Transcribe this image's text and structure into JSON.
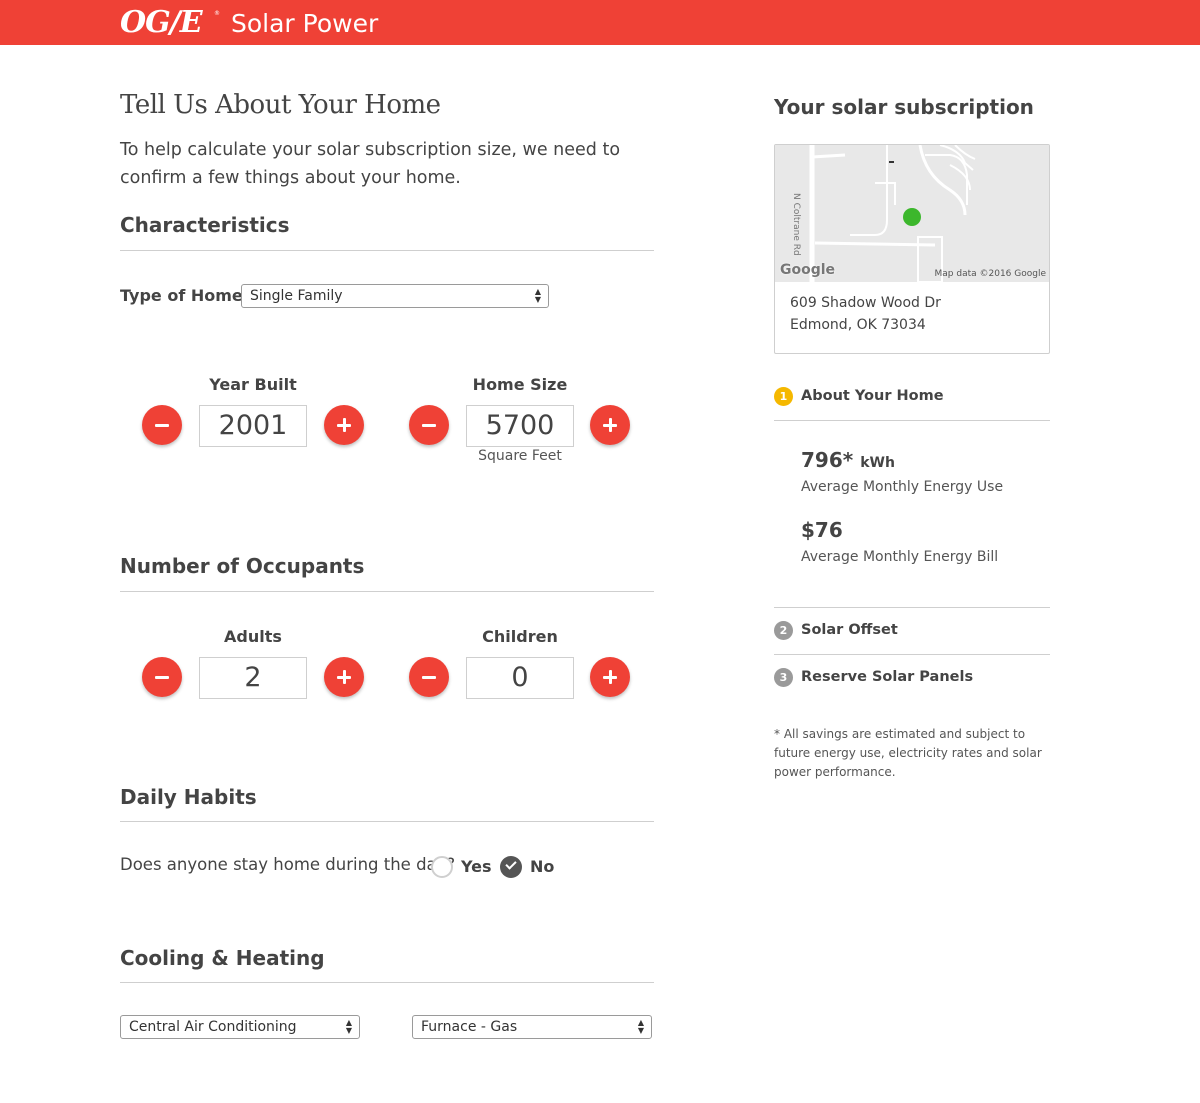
{
  "header": {
    "logo": "OG/E",
    "logo_mark": "®",
    "product": "Solar Power"
  },
  "intro": {
    "title": "Tell Us About Your Home",
    "text": "To help calculate your solar subscription size, we need to confirm a few things about your home."
  },
  "characteristics": {
    "title": "Characteristics",
    "type_label": "Type of Home",
    "type_value": "Single Family",
    "year_built": {
      "label": "Year Built",
      "value": "2001"
    },
    "home_size": {
      "label": "Home Size",
      "value": "5700",
      "unit": "Square Feet"
    }
  },
  "occupants": {
    "title": "Number of Occupants",
    "adults": {
      "label": "Adults",
      "value": "2"
    },
    "children": {
      "label": "Children",
      "value": "0"
    }
  },
  "habits": {
    "title": "Daily Habits",
    "question": "Does anyone stay home during the day?",
    "yes_label": "Yes",
    "no_label": "No",
    "selected": "No"
  },
  "cooling": {
    "title": "Cooling & Heating",
    "cooling_value": "Central Air Conditioning",
    "heating_value": "Furnace - Gas"
  },
  "sidebar": {
    "title": "Your solar subscription",
    "map": {
      "road": "N Coltrane Rd",
      "google": "Google",
      "credit": "Map data ©2016 Google"
    },
    "address_line1": "609 Shadow Wood Dr",
    "address_line2": "Edmond, OK 73034",
    "steps": [
      {
        "number": "1",
        "label": "About Your Home",
        "active": true
      },
      {
        "number": "2",
        "label": "Solar Offset",
        "active": false
      },
      {
        "number": "3",
        "label": "Reserve Solar Panels",
        "active": false
      }
    ],
    "energy_use": {
      "value": "796*",
      "unit": "kWh",
      "label": "Average Monthly Energy Use"
    },
    "energy_bill": {
      "value": "$76",
      "label": "Average Monthly Energy Bill"
    },
    "footnote": "* All savings are estimated and subject to future energy use, electricity rates and solar power performance."
  },
  "colors": {
    "brand": "#ef4136",
    "active_step": "#f5b800",
    "map_pin": "#3cb72c"
  }
}
